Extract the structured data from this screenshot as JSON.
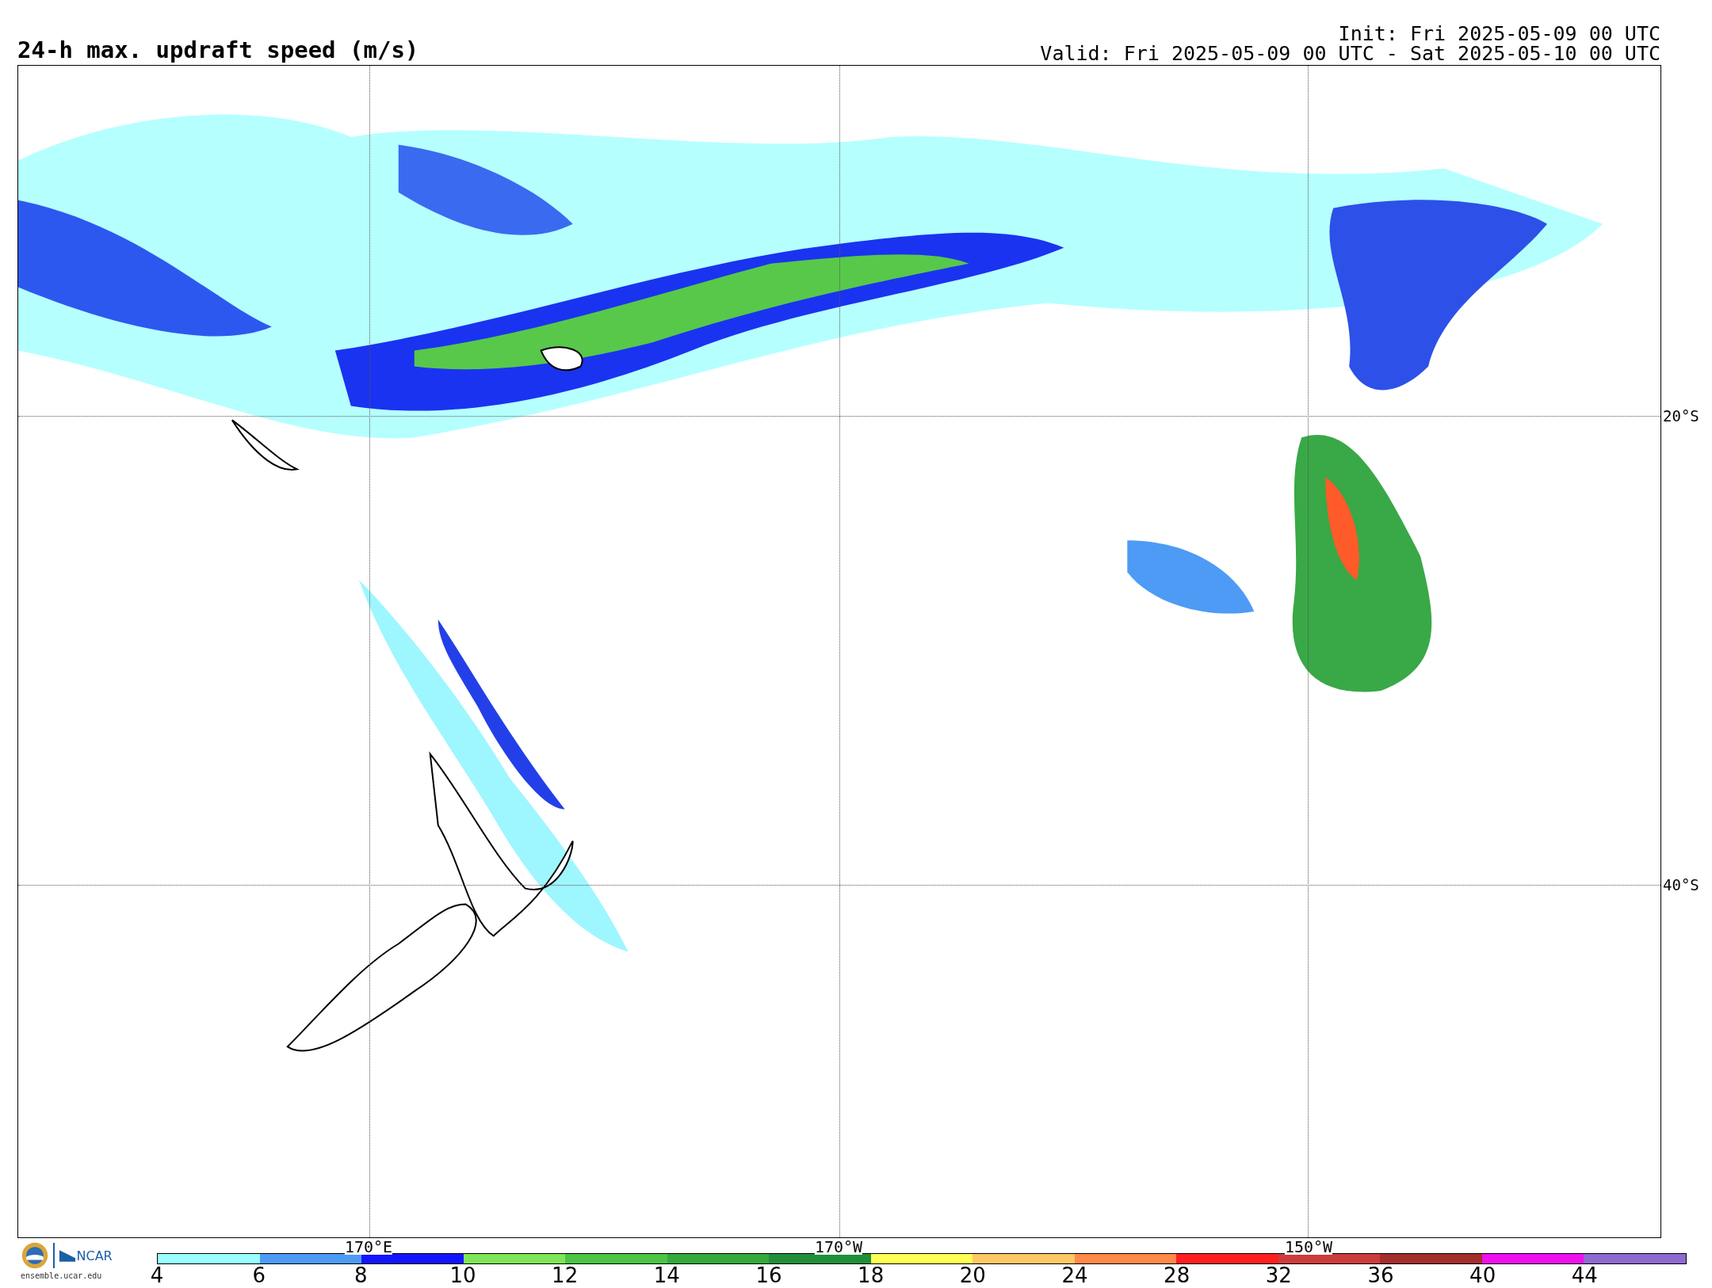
{
  "title": "24-h max. updraft speed (m/s)",
  "init": "Init: Fri 2025-05-09 00 UTC",
  "valid": "Valid: Fri 2025-05-09 00 UTC - Sat 2025-05-10 00 UTC",
  "map": {
    "lat_labels": [
      "20°S",
      "40°S"
    ],
    "lon_labels": [
      "170°E",
      "170°W",
      "150°W"
    ]
  },
  "colorbar": {
    "segments": [
      {
        "color": "#99ffff"
      },
      {
        "color": "#4e9bf5"
      },
      {
        "color": "#1414ff"
      },
      {
        "color": "#7fe55a"
      },
      {
        "color": "#4cc444"
      },
      {
        "color": "#33aa3c"
      },
      {
        "color": "#1f8f3a"
      },
      {
        "color": "#ffff55"
      },
      {
        "color": "#ffc865"
      },
      {
        "color": "#ff8a4c"
      },
      {
        "color": "#ff1f1f"
      },
      {
        "color": "#cc3c3c"
      },
      {
        "color": "#a32e2e"
      },
      {
        "color": "#ee11ee"
      },
      {
        "color": "#8e6ad0"
      }
    ],
    "ticks": [
      "4",
      "6",
      "8",
      "10",
      "12",
      "14",
      "16",
      "18",
      "20",
      "24",
      "28",
      "32",
      "36",
      "40",
      "44"
    ]
  },
  "footer": {
    "logo_text": "NCAR",
    "site": "ensemble.ucar.edu"
  }
}
